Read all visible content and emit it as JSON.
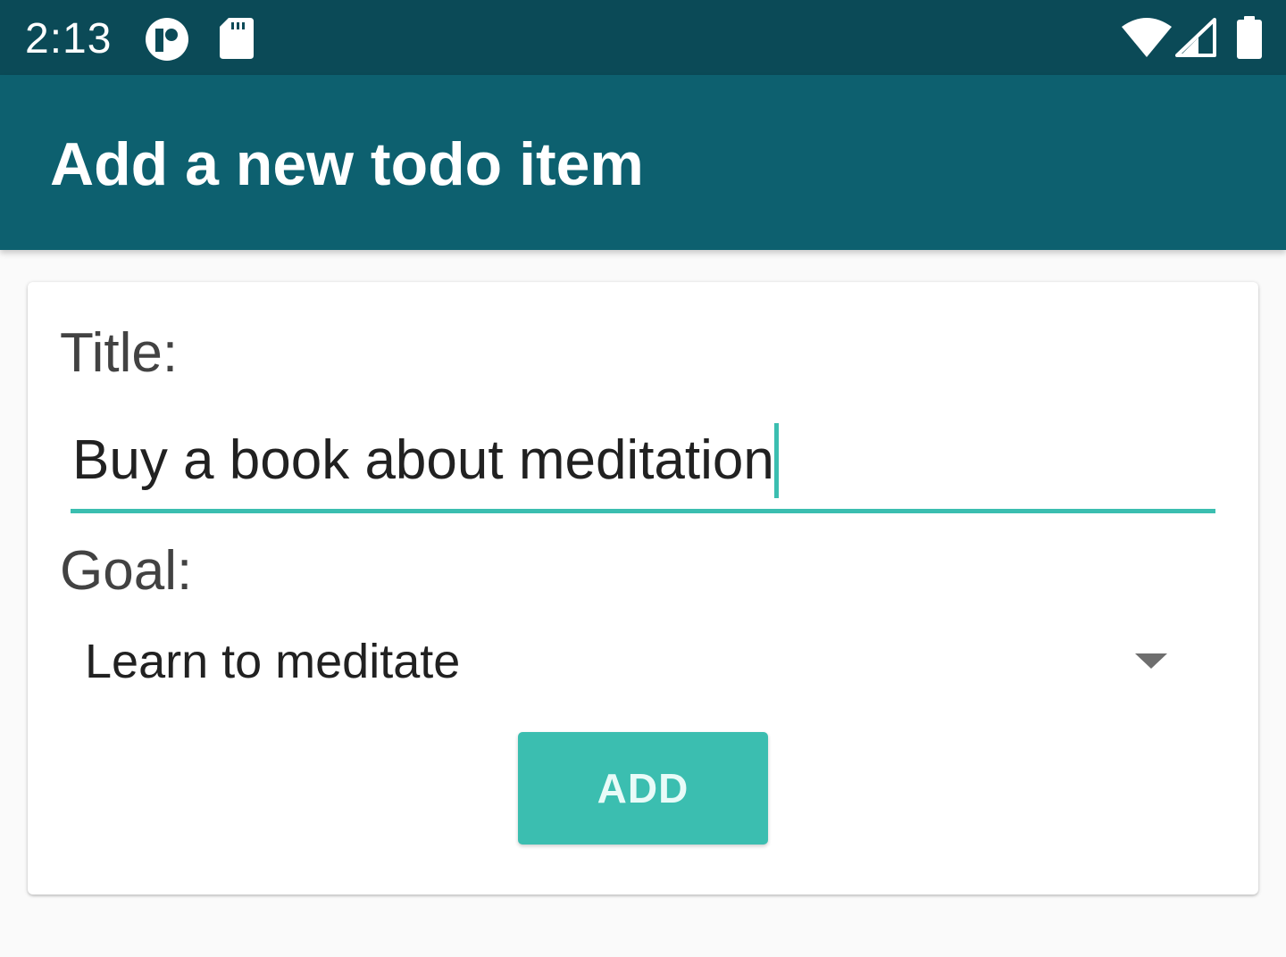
{
  "status_bar": {
    "time": "2:13",
    "left_icons": [
      "app-notification-icon",
      "sd-card-icon"
    ],
    "right_icons": [
      "wifi-icon",
      "cell-signal-icon",
      "battery-icon"
    ]
  },
  "app_bar": {
    "title": "Add a new todo item"
  },
  "form": {
    "title_label": "Title:",
    "title_value": "Buy a book about meditation",
    "goal_label": "Goal:",
    "goal_selected": "Learn to meditate",
    "add_button_label": "ADD"
  },
  "colors": {
    "status_bar": "#0b4a57",
    "app_bar": "#0d606f",
    "accent": "#3bbeb0",
    "background": "#fafafa"
  }
}
